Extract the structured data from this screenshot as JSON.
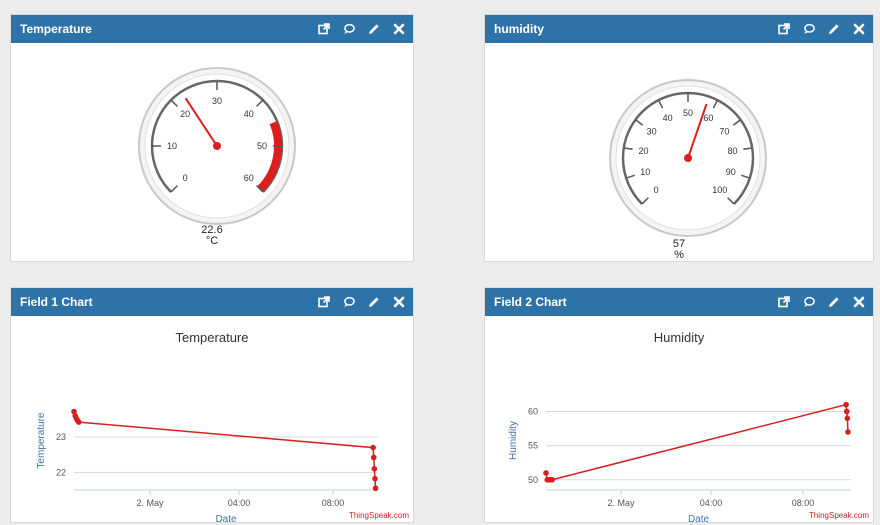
{
  "widgets": {
    "temperature": {
      "title": "Temperature",
      "value": 22.6,
      "value_text": "22.6",
      "units": "°C",
      "min": 0,
      "max": 60,
      "redFrom": 45,
      "redTo": 60,
      "ticks": [
        "0",
        "10",
        "20",
        "30",
        "40",
        "50",
        "60"
      ],
      "tick_values": [
        0,
        10,
        20,
        30,
        40,
        50,
        60
      ]
    },
    "humidity": {
      "title": "humidity",
      "value": 57,
      "value_text": "57",
      "units": "%",
      "min": 0,
      "max": 100,
      "ticks": [
        "0",
        "10",
        "20",
        "30",
        "40",
        "50",
        "60",
        "70",
        "80",
        "90",
        "100"
      ],
      "tick_values": [
        0,
        10,
        20,
        30,
        40,
        50,
        60,
        70,
        80,
        90,
        100
      ]
    },
    "field1": {
      "title": "Field 1 Chart",
      "credit": "ThingSpeak.com"
    },
    "field2": {
      "title": "Field 2 Chart",
      "credit": "ThingSpeak.com"
    }
  },
  "icons": [
    "external-link-icon",
    "comment-icon",
    "pencil-icon",
    "close-icon"
  ],
  "colors": {
    "header": "#2e73a8",
    "accent_red": "#d62020",
    "axis_blue": "#4572a7"
  },
  "chart_data": [
    {
      "type": "line",
      "title": "Temperature",
      "xlabel": "Date",
      "ylabel": "Temperature",
      "x_ticks": [
        "2. May",
        "04:00",
        "08:00"
      ],
      "y_ticks": [
        22,
        23
      ],
      "ylim": [
        21.5,
        24.3
      ],
      "series": [
        {
          "color": "#d62020",
          "points": [
            {
              "x": 0.0,
              "y": 23.72
            },
            {
              "x": 0.4,
              "y": 23.6
            },
            {
              "x": 0.8,
              "y": 23.52
            },
            {
              "x": 1.2,
              "y": 23.46
            },
            {
              "x": 1.6,
              "y": 23.42
            },
            {
              "x": 98.4,
              "y": 22.7
            },
            {
              "x": 98.6,
              "y": 22.42
            },
            {
              "x": 98.8,
              "y": 22.1
            },
            {
              "x": 99.0,
              "y": 21.82
            },
            {
              "x": 99.2,
              "y": 21.55
            }
          ]
        }
      ]
    },
    {
      "type": "line",
      "title": "Humidity",
      "xlabel": "Date",
      "ylabel": "Humidity",
      "x_ticks": [
        "2. May",
        "04:00",
        "08:00"
      ],
      "y_ticks": [
        50,
        55,
        60
      ],
      "ylim": [
        48.5,
        63
      ],
      "series": [
        {
          "color": "#d62020",
          "points": [
            {
              "x": 0.0,
              "y": 51
            },
            {
              "x": 0.4,
              "y": 50
            },
            {
              "x": 0.8,
              "y": 50
            },
            {
              "x": 1.2,
              "y": 50
            },
            {
              "x": 1.6,
              "y": 50
            },
            {
              "x": 2.0,
              "y": 50
            },
            {
              "x": 98.4,
              "y": 61
            },
            {
              "x": 98.6,
              "y": 60
            },
            {
              "x": 98.8,
              "y": 59
            },
            {
              "x": 99.0,
              "y": 57
            }
          ]
        }
      ]
    }
  ]
}
